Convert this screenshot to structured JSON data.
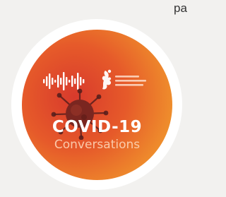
{
  "header": {
    "corner_text": "pa"
  },
  "podcast": {
    "title": "COVID-19",
    "subtitle": "Conversations",
    "logo_lines": [
      "(...)",
      "(...)",
      "(...)"
    ]
  },
  "colors": {
    "background": "#f2f1ef",
    "ring": "#ffffff",
    "badge_center": "#e2472b",
    "badge_edge": "#ef8a2a",
    "title": "#ffffff"
  },
  "icons": {
    "waveform": "sound-wave-icon",
    "virus": "virus-icon",
    "organization": "organization-logo"
  }
}
